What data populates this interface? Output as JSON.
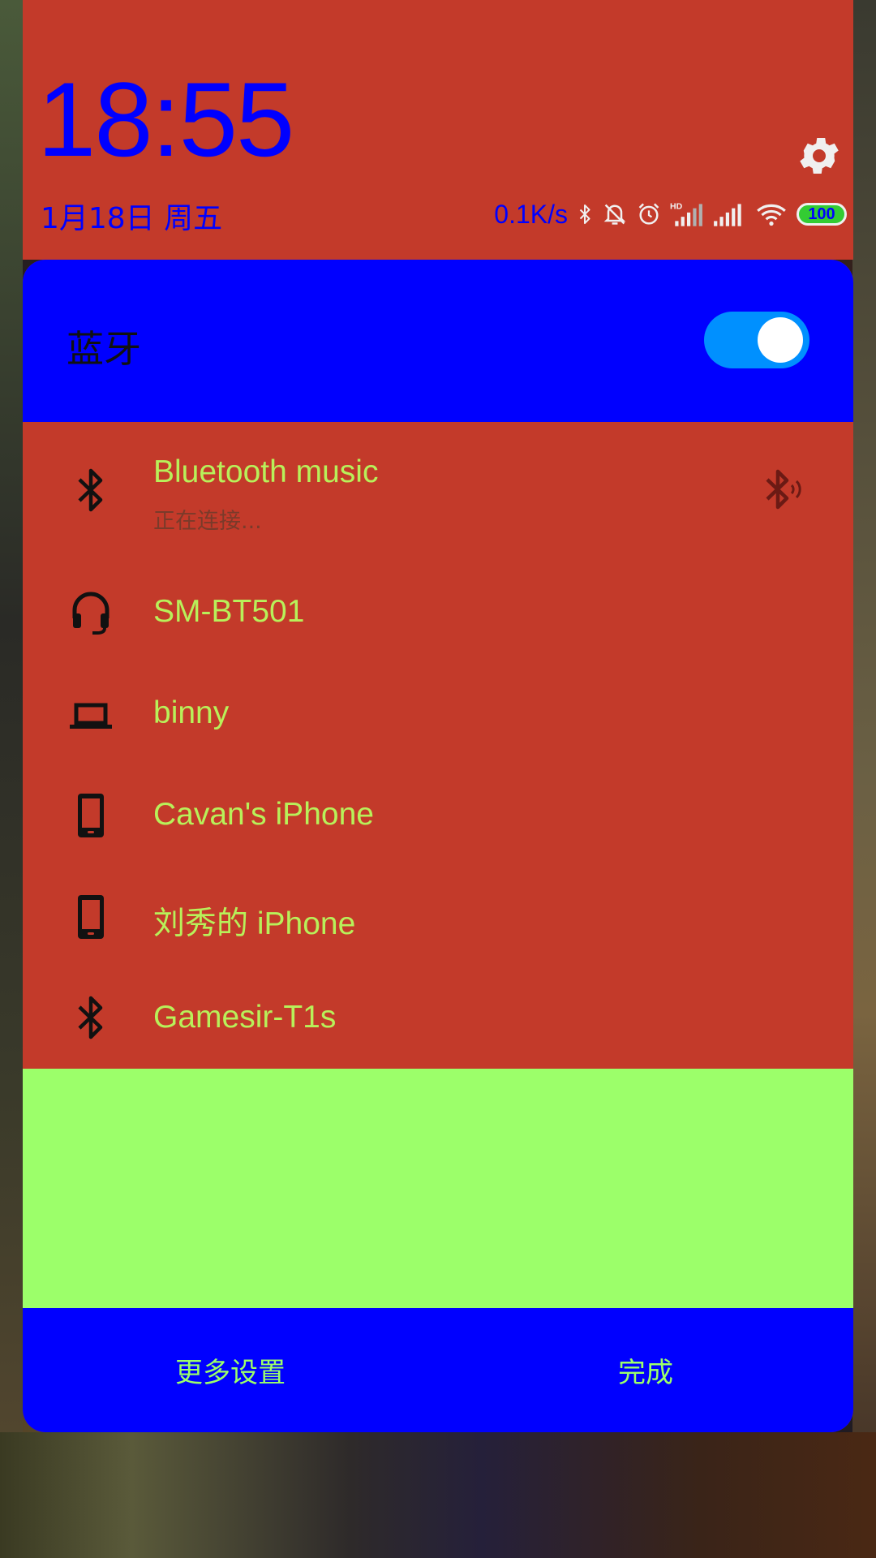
{
  "status": {
    "time": "18:55",
    "date": "1月18日 周五",
    "net_speed": "0.1K/s",
    "battery": "100",
    "icons": [
      "bluetooth-icon",
      "silent-icon",
      "alarm-icon",
      "hd-signal-icon",
      "signal-icon",
      "wifi-icon",
      "battery-icon"
    ]
  },
  "panel": {
    "title": "蓝牙",
    "toggle_on": true,
    "devices": [
      {
        "name": "Bluetooth music",
        "status": "正在连接...",
        "icon": "bluetooth-icon"
      },
      {
        "name": "SM-BT501",
        "icon": "headset-icon"
      },
      {
        "name": "binny",
        "icon": "laptop-icon"
      },
      {
        "name": "Cavan's iPhone",
        "icon": "phone-icon"
      },
      {
        "name": "刘秀的 iPhone",
        "icon": "phone-icon"
      },
      {
        "name": "Gamesir-T1s",
        "icon": "bluetooth-icon"
      }
    ]
  },
  "footer": {
    "more_settings": "更多设置",
    "done": "完成"
  },
  "colors": {
    "header_bg": "#c33a2a",
    "accent_blue": "#0000ff",
    "device_text": "#b8f05a",
    "green_area": "#9cff6a",
    "toggle": "#0090ff"
  }
}
